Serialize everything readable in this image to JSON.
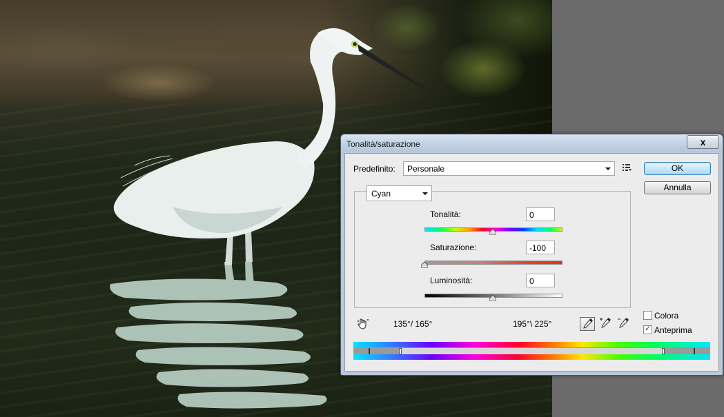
{
  "dialog": {
    "title": "Tonalità/saturazione",
    "close_label": "x",
    "preset": {
      "label": "Predefinito:",
      "value": "Personale"
    },
    "buttons": {
      "ok": "OK",
      "cancel": "Annulla"
    },
    "channel": {
      "value": "Cyan"
    },
    "sliders": {
      "hue": {
        "label": "Tonalità:",
        "value": "0"
      },
      "saturation": {
        "label": "Saturazione:",
        "value": "-100"
      },
      "lightness": {
        "label": "Luminosità:",
        "value": "0"
      }
    },
    "ranges": {
      "left": "135°/ 165°",
      "right": "195°\\ 225°"
    },
    "options": {
      "colorize": {
        "label": "Colora",
        "checked": false
      },
      "preview": {
        "label": "Anteprima",
        "checked": true
      }
    }
  },
  "icons": {
    "hand": "hand-icon",
    "eyedropper": "eyedropper-icon",
    "eyedropper_plus": "eyedropper-plus-icon",
    "eyedropper_minus": "eyedropper-minus-icon",
    "preset_menu": "preset-menu-icon"
  }
}
